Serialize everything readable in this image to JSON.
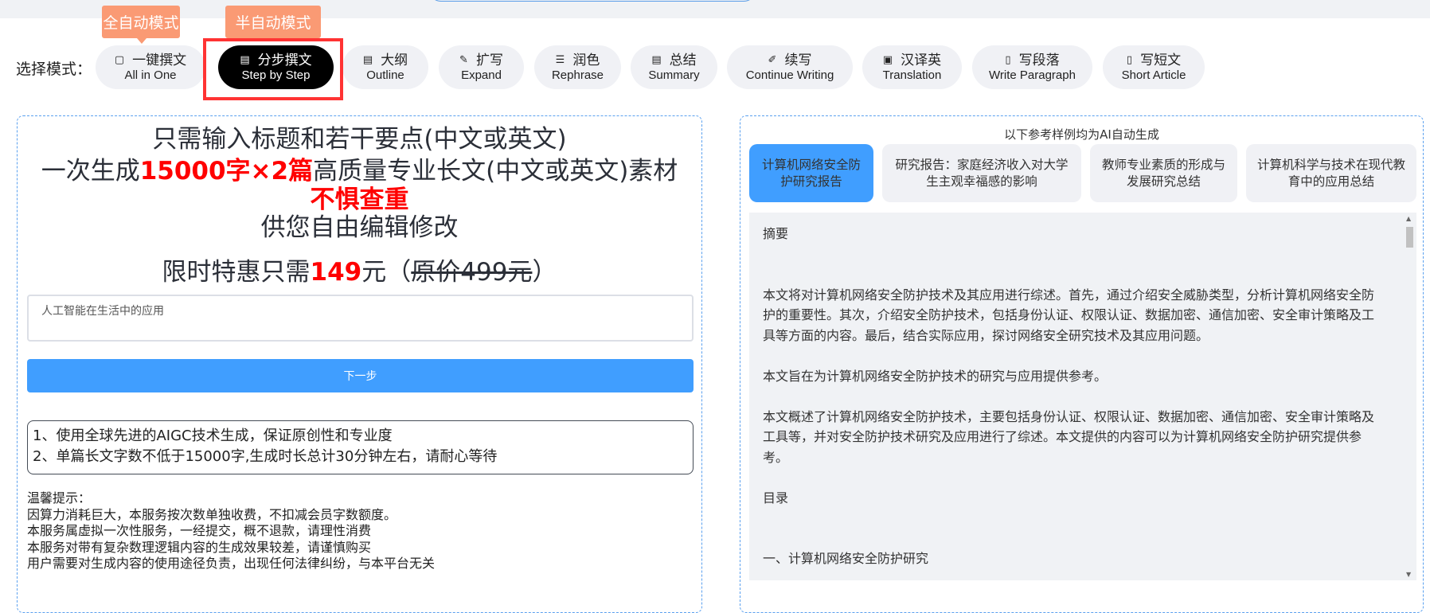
{
  "mode_tips": {
    "auto": "全自动模式",
    "semi": "半自动模式"
  },
  "mode_label": "选择模式：",
  "modes": [
    {
      "zh": "一键撰文",
      "en": "All in One",
      "icon": "chat-icon"
    },
    {
      "zh": "分步撰文",
      "en": "Step by Step",
      "icon": "document-icon",
      "active": true
    },
    {
      "zh": "大纲",
      "en": "Outline",
      "icon": "document-add-icon"
    },
    {
      "zh": "扩写",
      "en": "Expand",
      "icon": "edit-icon"
    },
    {
      "zh": "润色",
      "en": "Rephrase",
      "icon": "list-icon"
    },
    {
      "zh": "总结",
      "en": "Summary",
      "icon": "document-icon"
    },
    {
      "zh": "续写",
      "en": "Continue Writing",
      "icon": "pen-icon"
    },
    {
      "zh": "汉译英",
      "en": "Translation",
      "icon": "translate-icon"
    },
    {
      "zh": "写段落",
      "en": "Write Paragraph",
      "icon": "notebook-icon"
    },
    {
      "zh": "写短文",
      "en": "Short Article",
      "icon": "notebook-icon"
    }
  ],
  "promo": {
    "line1": "只需输入标题和若干要点(中文或英文)",
    "line2_a": "一次生成",
    "line2_b": "15000字×2篇",
    "line2_c": "高质量专业长文(中文或英文)素材",
    "line3": "不惧查重",
    "line4": "供您自由编辑修改",
    "price_a": "限时特惠只需",
    "price_b": "149",
    "price_c": "元（",
    "price_orig": "原价499元",
    "price_d": "）"
  },
  "title_input": {
    "value": "人工智能在生活中的应用"
  },
  "next_button": "下一步",
  "features": [
    "1、使用全球先进的AIGC技术生成，保证原创性和专业度",
    "2、单篇长文字数不低于15000字,生成时长总计30分钟左右，请耐心等待"
  ],
  "notice": [
    "温馨提示：",
    "因算力消耗巨大，本服务按次数单独收费，不扣减会员字数额度。",
    "本服务属虚拟一次性服务，一经提交，概不退款，请理性消费",
    "本服务对带有复杂数理逻辑内容的生成效果较差，请谨慎购买",
    "用户需要对生成内容的使用途径负责，出现任何法律纠纷，与本平台无关"
  ],
  "samples_caption": "以下参考样例均为AI自动生成",
  "sample_tabs": [
    {
      "label": "计算机网络安全防护研究报告",
      "active": true
    },
    {
      "label": "研究报告：家庭经济收入对大学生主观幸福感的影响"
    },
    {
      "label": "教师专业素质的形成与发展研究总结"
    },
    {
      "label": "计算机科学与技术在现代教育中的应用总结"
    }
  ],
  "sample_content": [
    "摘要",
    "",
    "",
    "本文将对计算机网络安全防护技术及其应用进行综述。首先，通过介绍安全威胁类型，分析计算机网络安全防护的重要性。其次，介绍安全防护技术，包括身份认证、权限认证、数据加密、通信加密、安全审计策略及工具等方面的内容。最后，结合实际应用，探讨网络安全研究技术及其应用问题。",
    "",
    "本文旨在为计算机网络安全防护技术的研究与应用提供参考。",
    "",
    "本文概述了计算机网络安全防护技术，主要包括身份认证、权限认证、数据加密、通信加密、安全审计策略及工具等，并对安全防护技术研究及应用进行了综述。本文提供的内容可以为计算机网络安全防护研究提供参考。",
    "",
    "目录",
    "",
    "",
    "一、计算机网络安全防护研究"
  ],
  "colors": {
    "accent": "#409eff",
    "tip": "#fa9a74",
    "highlight": "#ff0000",
    "active_mode": "#000000"
  }
}
